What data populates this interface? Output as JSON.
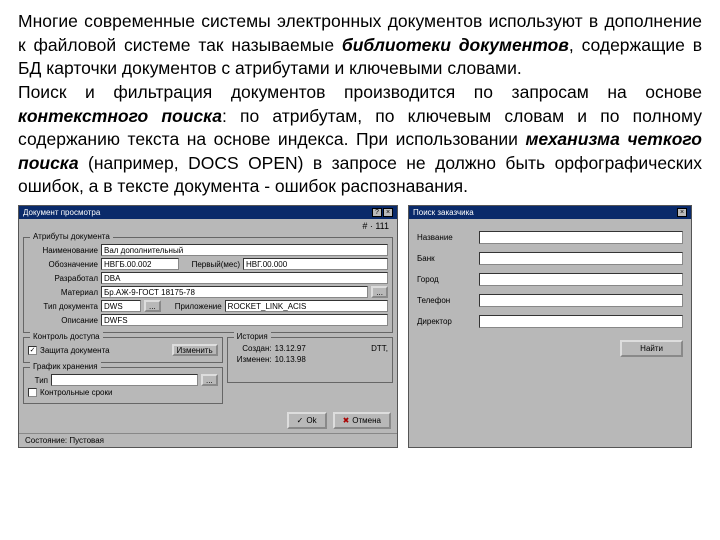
{
  "paragraph": {
    "t1": "Многие современные системы электронных документов используют в дополнение к файловой системе так называемые ",
    "b1": "библиотеки документов",
    "t2": ", содержащие в БД карточки документов с атрибутами и ключевыми словами.",
    "t3": "Поиск и фильтрация документов производится по запросам на основе ",
    "b2": "контекстного поиска",
    "t4": ": по атрибутам, по ключевым словам и по полному содержанию текста на основе индекса. При использовании ",
    "b3": "механизма четкого поиска",
    "t5": " (например, DOCS OPEN) в запросе не должно быть орфографических ошибок, а в тексте документа - ошибок распознавания."
  },
  "left": {
    "title": "Документ просмотра",
    "header_num": "# · 111",
    "group_attrs": "Атрибуты документа",
    "labels": {
      "name": "Наименование",
      "designation": "Обозначение",
      "first_used": "Первый(мес)",
      "developed": "Разработал",
      "material": "Материал",
      "doc_type": "Тип документа",
      "attachment": "Приложение",
      "description": "Описание"
    },
    "values": {
      "name": "Вал дополнительный",
      "designation": "НВГБ.00.002",
      "first_used": "НВГ.00.000",
      "developed": "DBA",
      "material": "Бр.АЖ-9-ГОСТ 18175-78",
      "doc_type": "DWS",
      "attachment": "ROCKET_LINK_ACIS",
      "description": "DWFS"
    },
    "ellipsis": "...",
    "access_group": "Контроль доступа",
    "protect_doc": "Защита документа",
    "change_btn": "Изменить",
    "history_group": "История",
    "created_lbl": "Создан:",
    "created_val": "13.12.97",
    "changed_lbl": "Изменен:",
    "changed_val": "10.13.98",
    "dtt": "DTT,",
    "storage_group": "График хранения",
    "type_lbl": "Тип",
    "control_term": "Контрольные сроки",
    "ok": "Ok",
    "cancel": "Отмена",
    "status_lbl": "Состояние:",
    "status_val": "Пустовая"
  },
  "right": {
    "title": "Поиск заказчика",
    "labels": {
      "name": "Название",
      "bank": "Банк",
      "city": "Город",
      "phone": "Телефон",
      "director": "Директор"
    },
    "find": "Найти"
  }
}
